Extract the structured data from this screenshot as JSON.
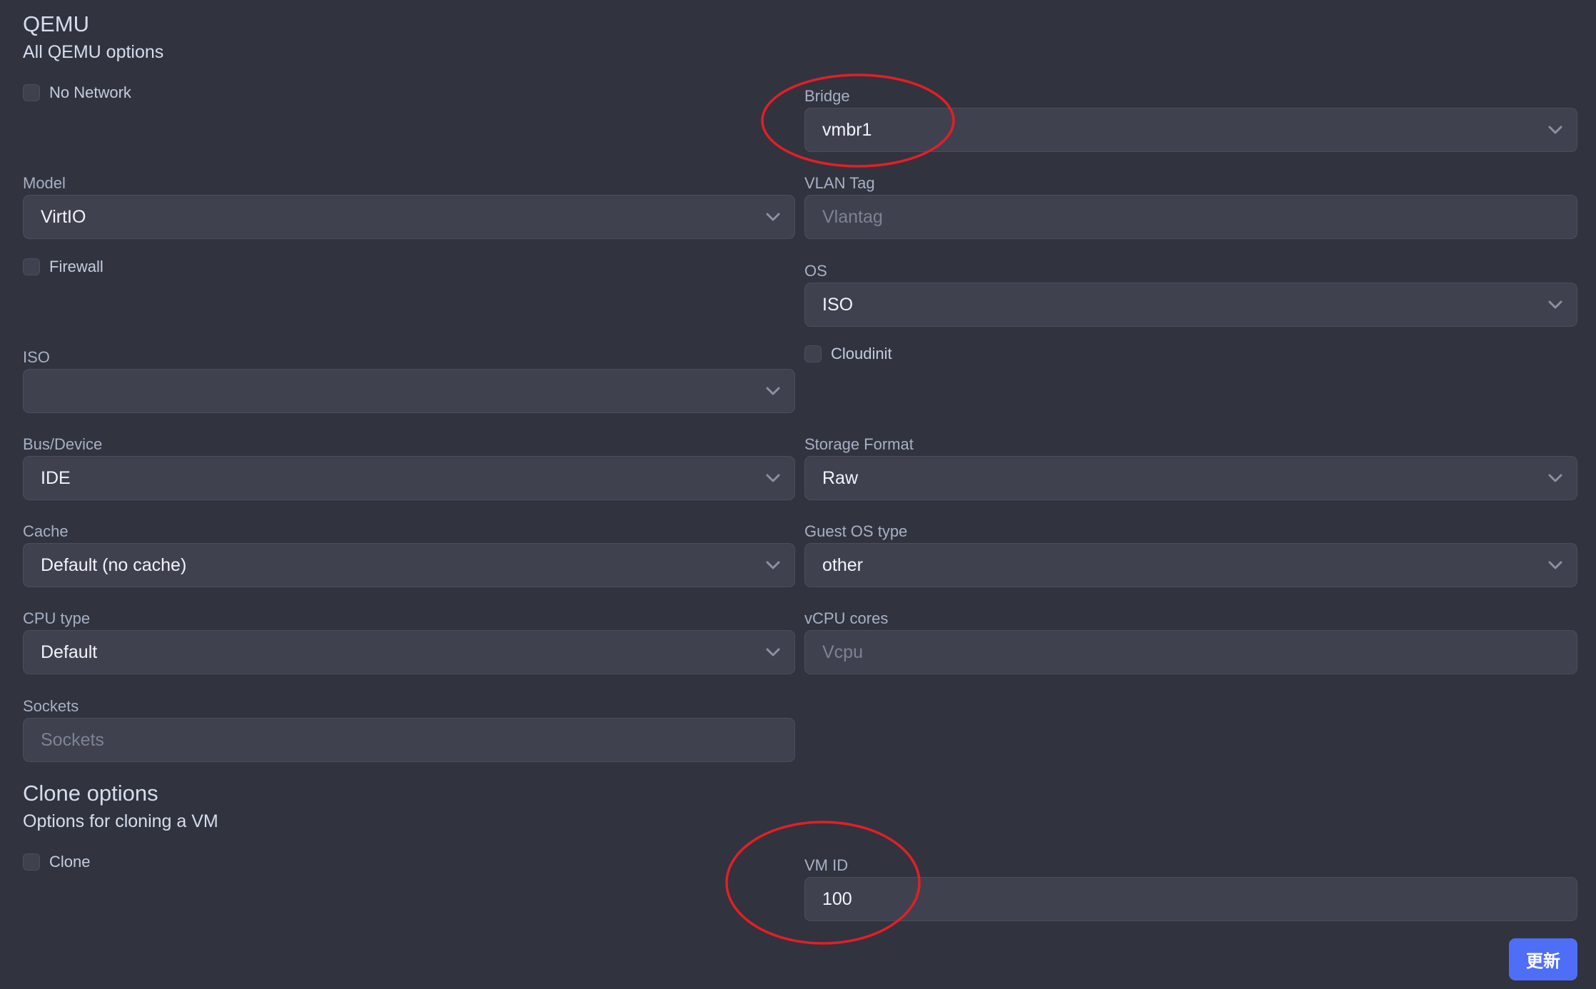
{
  "qemu": {
    "title": "QEMU",
    "subtitle": "All QEMU options",
    "no_network": {
      "label": "No Network",
      "checked": false
    },
    "bridge": {
      "label": "Bridge",
      "value": "vmbr1",
      "icon": "chevron-down-icon"
    },
    "model": {
      "label": "Model",
      "value": "VirtIO",
      "icon": "chevron-down-icon"
    },
    "vlan_tag": {
      "label": "VLAN Tag",
      "value": "",
      "placeholder": "Vlantag"
    },
    "firewall": {
      "label": "Firewall",
      "checked": false
    },
    "os": {
      "label": "OS",
      "value": "ISO",
      "icon": "chevron-down-icon"
    },
    "cloudinit": {
      "label": "Cloudinit",
      "checked": false
    },
    "iso": {
      "label": "ISO",
      "value": "",
      "icon": "chevron-down-icon"
    },
    "bus_device": {
      "label": "Bus/Device",
      "value": "IDE",
      "icon": "chevron-down-icon"
    },
    "storage_format": {
      "label": "Storage Format",
      "value": "Raw",
      "icon": "chevron-down-icon"
    },
    "cache": {
      "label": "Cache",
      "value": "Default (no cache)",
      "icon": "chevron-down-icon"
    },
    "guest_os_type": {
      "label": "Guest OS type",
      "value": "other",
      "icon": "chevron-down-icon"
    },
    "cpu_type": {
      "label": "CPU type",
      "value": "Default",
      "icon": "chevron-down-icon"
    },
    "vcpu_cores": {
      "label": "vCPU cores",
      "value": "",
      "placeholder": "Vcpu"
    },
    "sockets": {
      "label": "Sockets",
      "value": "",
      "placeholder": "Sockets"
    }
  },
  "clone": {
    "title": "Clone options",
    "subtitle": "Options for cloning a VM",
    "clone_checkbox": {
      "label": "Clone",
      "checked": false
    },
    "vm_id": {
      "label": "VM ID",
      "value": "100"
    }
  },
  "actions": {
    "update_label": "更新"
  },
  "colors": {
    "background": "#31333f",
    "field_fill": "#3f414f",
    "field_border": "#4b4e5c",
    "accent_button": "#4f6ef7",
    "annotation_red": "#e21f26"
  },
  "annotations": [
    {
      "type": "ellipse",
      "target": "bridge-select",
      "color": "#e21f26"
    },
    {
      "type": "ellipse",
      "target": "vm-id-input",
      "color": "#e21f26"
    }
  ]
}
